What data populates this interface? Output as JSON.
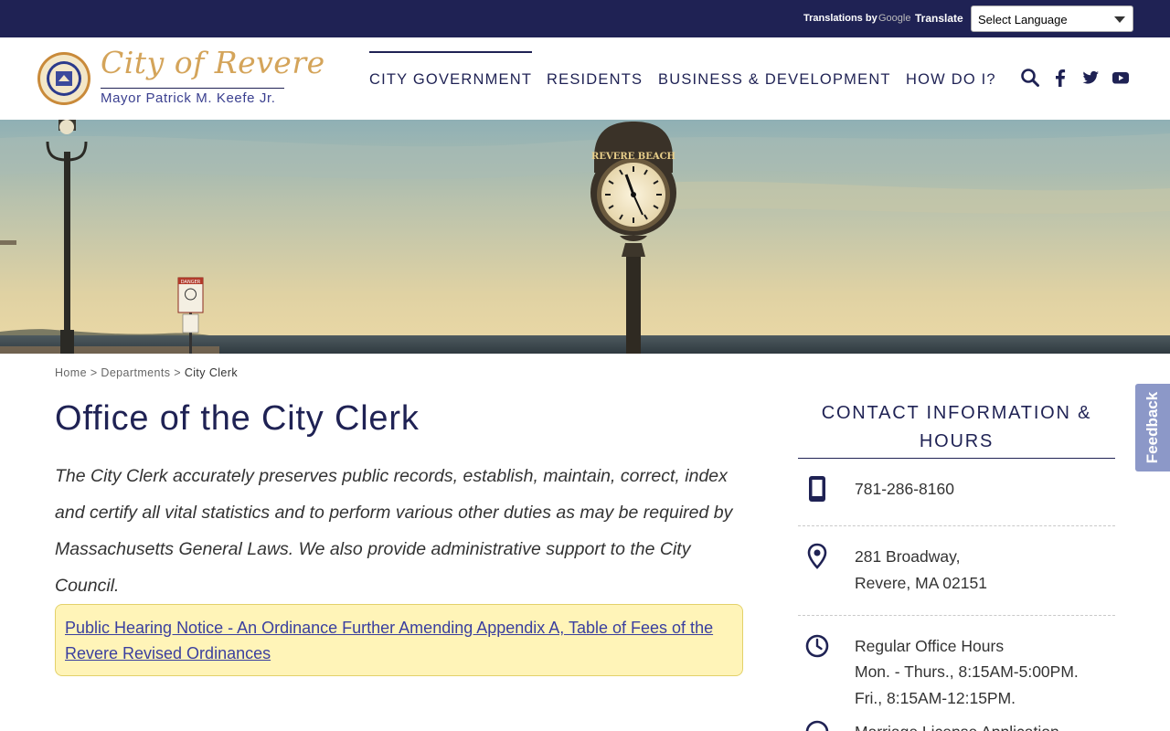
{
  "topbar": {
    "translations_by": "Translations by",
    "google": "Google",
    "translate": "Translate",
    "language_select": "Select Language"
  },
  "brand": {
    "title": "City of Revere",
    "mayor": "Mayor Patrick M. Keefe Jr."
  },
  "nav": {
    "items": [
      {
        "label": "CITY GOVERNMENT"
      },
      {
        "label": "RESIDENTS"
      },
      {
        "label": "BUSINESS & DEVELOPMENT"
      },
      {
        "label": "HOW DO I?"
      }
    ],
    "icons": [
      "search-icon",
      "facebook-icon",
      "twitter-icon",
      "youtube-icon"
    ]
  },
  "hero": {
    "clock_sign": "REVERE BEACH",
    "danger_sign": "DANGER"
  },
  "breadcrumb": {
    "home": "Home",
    "sep": ">",
    "departments": "Departments",
    "current": "City Clerk"
  },
  "main": {
    "title": "Office of the City Clerk",
    "intro": "The City Clerk accurately preserves public records, establish, maintain, correct, index and certify all vital statistics and to perform various other duties as may be required by Massachusetts General Laws. We also provide administrative support to the City Council.",
    "notice_link": "Public Hearing Notice - An Ordinance Further Amending Appendix A, Table of Fees of the Revere Revised Ordinances"
  },
  "contact": {
    "title": "CONTACT INFORMATION & HOURS",
    "phone": "781-286-8160",
    "address_line1": "281 Broadway,",
    "address_line2": "Revere, MA 02151",
    "hours_title": "Regular Office Hours",
    "hours_line1": "Mon. - Thurs., 8:15AM-5:00PM.",
    "hours_line2": "Fri., 8:15AM-12:15PM.",
    "next_partial": "Marriage License Application"
  },
  "feedback": "Feedback",
  "colors": {
    "navy": "#1f2254",
    "gold": "#d4a45a",
    "notice_bg": "#fff4b8",
    "link": "#3a3f9f"
  }
}
